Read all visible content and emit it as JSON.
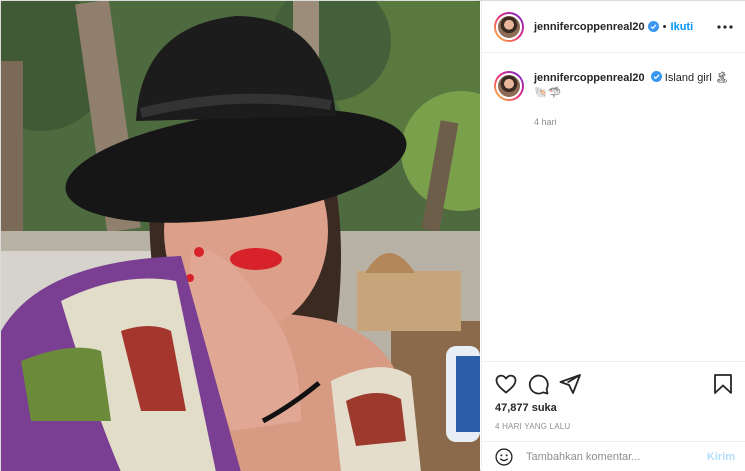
{
  "post": {
    "image_alt": "",
    "author": {
      "username": "jennifercoppenreal20",
      "verified": true
    },
    "follow_label": "Ikuti",
    "dot": "•",
    "caption": {
      "username": "jennifercoppenreal20",
      "text": "Island girl 🏝",
      "emoji_line": "🐚🦈",
      "time": "4 hari"
    },
    "likes": "47,877 suka",
    "posted_time": "4 HARI YANG LALU",
    "comment": {
      "placeholder": "Tambahkan komentar...",
      "send_label": "Kirim"
    },
    "icons": {
      "more": "more-options-icon",
      "like": "heart-icon",
      "comment": "comment-icon",
      "share": "share-icon",
      "save": "bookmark-icon",
      "emoji": "emoji-icon",
      "verified": "verified-badge-icon"
    },
    "colors": {
      "link_blue": "#0095f6",
      "send_disabled": "#b2dffc",
      "verified_blue": "#3897f0",
      "muted_text": "#8e8e8e"
    }
  }
}
